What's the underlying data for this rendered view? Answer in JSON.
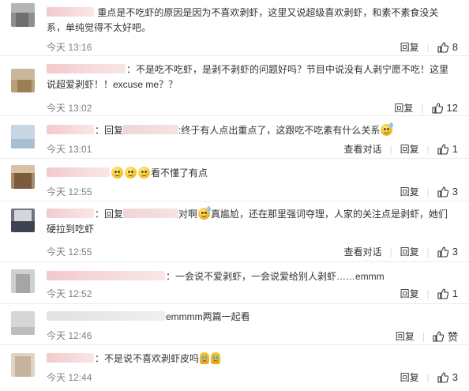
{
  "actions": {
    "reply_label": "回复",
    "view_thread_label": "查看对话",
    "like_label": "赞"
  },
  "comments": [
    {
      "text": "重点是不吃虾的原因是因为不喜欢剥虾，这里又说超级喜欢剥虾，和素不素食没关系，单纯觉得不太好吧。",
      "time": "今天 13:16",
      "likes": "8"
    },
    {
      "text": "：不是吃不吃虾，是剥不剥虾的问题好吗？节目中说没有人剥宁愿不吃！这里说超爱剥虾！！excuse me？？",
      "time": "今天 13:02",
      "likes": "12"
    },
    {
      "reply_prefix": "：回复",
      "text": ":终于有人点出重点了，这跟吃不吃素有什么关系",
      "time": "今天 13:01",
      "likes": "1"
    },
    {
      "text": "看不懂了有点",
      "time": "今天 12:55",
      "likes": "3"
    },
    {
      "reply_prefix": "：回复",
      "text_a": "对啊",
      "text_b": "真尴尬，还在那里强词夺理，人家的关注点是剥虾，她们硬拉到吃虾",
      "time": "今天 12:55",
      "likes": "3"
    },
    {
      "text": "：一会说不爱剥虾，一会说爱给别人剥虾……emmm",
      "time": "今天 12:52",
      "likes": "1"
    },
    {
      "text": "emmmm两篇一起看",
      "time": "今天 12:46"
    },
    {
      "text": "：不是说不喜欢剥虾皮吗",
      "time": "今天 12:44",
      "likes": "3"
    }
  ],
  "icons": [
    "thumbs-up-icon",
    "smile-emoji-icon",
    "sweat-emoji-icon",
    "cry-emoji-icon"
  ],
  "colors": {
    "text": "#333333",
    "meta": "#808080",
    "divider": "#ececec",
    "name_blur": "#f3c9cc"
  }
}
